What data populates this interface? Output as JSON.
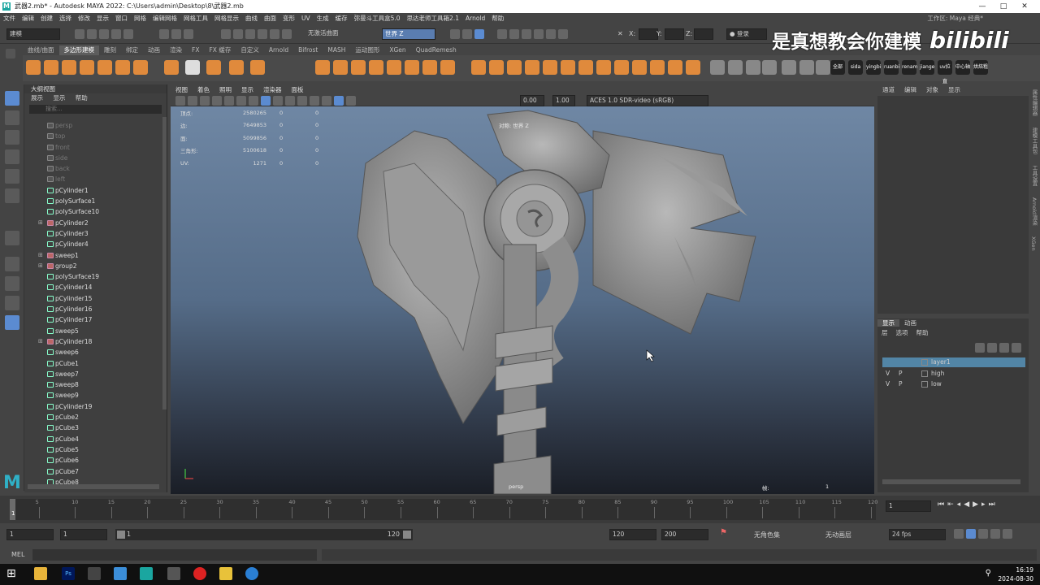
{
  "window": {
    "title": "武器2.mb* - Autodesk MAYA 2022: C:\\Users\\admin\\Desktop\\8\\武器2.mb",
    "controls": [
      "—",
      "□",
      "✕"
    ]
  },
  "menubar": [
    "文件",
    "编辑",
    "创建",
    "选择",
    "修改",
    "显示",
    "窗口",
    "网格",
    "编辑网格",
    "网格工具",
    "网格显示",
    "曲线",
    "曲面",
    "变形",
    "UV",
    "生成",
    "缓存",
    "弥曼斗工具盒5.0",
    "思达老师工具箱2.1",
    "Arnold",
    "帮助"
  ],
  "workspace": {
    "label": "工作区:",
    "value": "Maya 经典*"
  },
  "statusline": {
    "mode_dropdown": "建模",
    "live_surface": "无激活曲面",
    "world_axis": "世界 Z",
    "x_label": "X:",
    "y_label": "Y:",
    "z_label": "Z:",
    "login": "登录"
  },
  "watermark": {
    "text": "是真想教会你建模",
    "logo": "bilibili"
  },
  "shelf": {
    "tabs": [
      "曲线/曲面",
      "多边形建模",
      "雕刻",
      "绑定",
      "动画",
      "渲染",
      "FX",
      "FX 缓存",
      "自定义",
      "Arnold",
      "Bifrost",
      "MASH",
      "运动图形",
      "XGen",
      "QuadRemesh"
    ],
    "active_tab": "多边形建模",
    "plugin_labels": [
      "全部",
      "sida",
      "yingbi",
      "ruanbi",
      "renam",
      "jiange",
      "uv拉直",
      "中心轴",
      "烘焙粗"
    ]
  },
  "outliner": {
    "title": "大纲视图",
    "menu": [
      "展示",
      "显示",
      "帮助"
    ],
    "search_placeholder": "搜索...",
    "items": [
      {
        "name": "persp",
        "type": "cam",
        "dim": true
      },
      {
        "name": "top",
        "type": "cam",
        "dim": true
      },
      {
        "name": "front",
        "type": "cam",
        "dim": true
      },
      {
        "name": "side",
        "type": "cam",
        "dim": true
      },
      {
        "name": "back",
        "type": "cam",
        "dim": true
      },
      {
        "name": "left",
        "type": "cam",
        "dim": true
      },
      {
        "name": "pCylinder1",
        "type": "mesh"
      },
      {
        "name": "polySurface1",
        "type": "mesh"
      },
      {
        "name": "polySurface10",
        "type": "mesh"
      },
      {
        "name": "pCylinder2",
        "type": "grp",
        "expand": true
      },
      {
        "name": "pCylinder3",
        "type": "mesh"
      },
      {
        "name": "pCylinder4",
        "type": "mesh"
      },
      {
        "name": "sweep1",
        "type": "grp",
        "expand": true
      },
      {
        "name": "group2",
        "type": "grp",
        "expand": true
      },
      {
        "name": "polySurface19",
        "type": "mesh"
      },
      {
        "name": "pCylinder14",
        "type": "mesh"
      },
      {
        "name": "pCylinder15",
        "type": "mesh"
      },
      {
        "name": "pCylinder16",
        "type": "mesh"
      },
      {
        "name": "pCylinder17",
        "type": "mesh"
      },
      {
        "name": "sweep5",
        "type": "mesh"
      },
      {
        "name": "pCylinder18",
        "type": "grp",
        "expand": true
      },
      {
        "name": "sweep6",
        "type": "mesh"
      },
      {
        "name": "pCube1",
        "type": "mesh"
      },
      {
        "name": "sweep7",
        "type": "mesh"
      },
      {
        "name": "sweep8",
        "type": "mesh"
      },
      {
        "name": "sweep9",
        "type": "mesh"
      },
      {
        "name": "pCylinder19",
        "type": "mesh"
      },
      {
        "name": "pCube2",
        "type": "mesh"
      },
      {
        "name": "pCube3",
        "type": "mesh"
      },
      {
        "name": "pCube4",
        "type": "mesh"
      },
      {
        "name": "pCube5",
        "type": "mesh"
      },
      {
        "name": "pCube6",
        "type": "mesh"
      },
      {
        "name": "pCube7",
        "type": "mesh"
      },
      {
        "name": "pCube8",
        "type": "mesh"
      }
    ]
  },
  "viewport": {
    "menu": [
      "视图",
      "着色",
      "照明",
      "显示",
      "渲染器",
      "面板"
    ],
    "exposure": "0.00",
    "gamma": "1.00",
    "colorspace": "ACES 1.0 SDR-video (sRGB)",
    "hud": [
      {
        "label": "顶点:",
        "value": "2580265",
        "a": "0",
        "b": "0"
      },
      {
        "label": "边:",
        "value": "7649853",
        "a": "0",
        "b": "0"
      },
      {
        "label": "面:",
        "value": "5099856",
        "a": "0",
        "b": "0"
      },
      {
        "label": "三角形:",
        "value": "5100618",
        "a": "0",
        "b": "0"
      },
      {
        "label": "UV:",
        "value": "1271",
        "a": "0",
        "b": "0"
      }
    ],
    "object_label": "对称: 世界 Z",
    "camera_label": "persp",
    "fps_label": "帧:",
    "frame_value": "1"
  },
  "channelbox": {
    "menu": [
      "通道",
      "编辑",
      "对象",
      "显示"
    ]
  },
  "layers": {
    "tabs": [
      "显示",
      "动画"
    ],
    "active_tab": "显示",
    "menu": [
      "层",
      "选项",
      "帮助"
    ],
    "rows": [
      {
        "v": "",
        "p": "",
        "name": "layer1",
        "selected": true
      },
      {
        "v": "V",
        "p": "P",
        "name": "high",
        "selected": false
      },
      {
        "v": "V",
        "p": "P",
        "name": "low",
        "selected": false
      }
    ]
  },
  "sidetabs": [
    "属性编辑器",
    "建模工具包",
    "工具设置",
    "Arnold渲染",
    "XGen"
  ],
  "timeline": {
    "ticks": [
      "5",
      "10",
      "15",
      "20",
      "25",
      "30",
      "35",
      "40",
      "45",
      "50",
      "55",
      "60",
      "65",
      "70",
      "75",
      "80",
      "85",
      "90",
      "95",
      "100",
      "105",
      "110",
      "115",
      "120"
    ],
    "current": "1",
    "current_field": "1"
  },
  "range": {
    "start": "1",
    "start2": "1",
    "slider_start": "1",
    "slider_end": "120",
    "end": "120",
    "end2": "200",
    "char_set": "无角色集",
    "anim_layer": "无动画层",
    "fps": "24 fps"
  },
  "cmdline": {
    "label": "MEL"
  },
  "clock": {
    "time": "16:19",
    "date": "2024-08-30"
  }
}
